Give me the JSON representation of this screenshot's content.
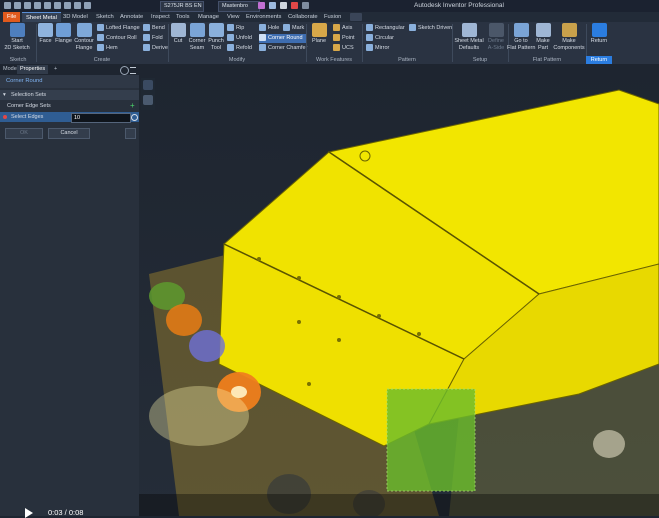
{
  "titlebar": {
    "material": "S275JR BS EN",
    "appearance": "Mastenbro",
    "app_title": "Autodesk Inventor Professional"
  },
  "tabs": [
    "File",
    "Sheet Metal",
    "3D Model",
    "Sketch",
    "Annotate",
    "Inspect",
    "Tools",
    "Manage",
    "View",
    "Environments",
    "Collaborate",
    "Fusion"
  ],
  "ribbon": {
    "groups": {
      "sketch": "Sketch",
      "create": "Create",
      "modify": "Modify",
      "work_features": "Work Features",
      "pattern": "Pattern",
      "setup": "Setup",
      "flat_pattern": "Flat Pattern",
      "return": "Return"
    },
    "start_sketch": "Start\n2D Sketch",
    "face": "Face",
    "flange": "Flange",
    "contour_flange": "Contour\nFlange",
    "lofted_flange": "Lofted Flange",
    "contour_roll": "Contour Roll",
    "hem": "Hem",
    "bend": "Bend",
    "fold": "Fold",
    "derive": "Derive",
    "cut": "Cut",
    "corner_seam": "Corner\nSeam",
    "punch_tool": "Punch\nTool",
    "rip": "Rip",
    "unfold": "Unfold",
    "refold": "Refold",
    "hole": "Hole",
    "mark": "Mark",
    "corner_round": "Corner Round",
    "corner_chamfer": "Corner Chamfer",
    "plane": "Plane",
    "axis": "Axis",
    "point": "Point",
    "ucs": "UCS",
    "rectangular": "Rectangular",
    "circular": "Circular",
    "mirror": "Mirror",
    "sketch_driven": "Sketch Driven",
    "sheet_metal_defaults": "Sheet Metal\nDefaults",
    "define_a_side": "Define\nA-Side",
    "go_to_flat_pattern": "Go to\nFlat Pattern",
    "make_part": "Make\nPart",
    "make_components": "Make\nComponents",
    "return_btn": "Return"
  },
  "panel": {
    "tab_model": "Model",
    "tab_properties": "Properties",
    "tab_add": "+",
    "header_title": "Corner Round",
    "section": "Selection Sets",
    "corner_edge_sets": "Corner Edge Sets",
    "select_edges_label": "Select Edges",
    "select_edges_value": "10",
    "ok": "OK",
    "cancel": "Cancel"
  },
  "video": {
    "time": "0:03 / 0:08"
  },
  "colors": {
    "accent": "#2b7de0",
    "file_tab": "#e15a1d",
    "model_yellow": "#f2e600"
  }
}
